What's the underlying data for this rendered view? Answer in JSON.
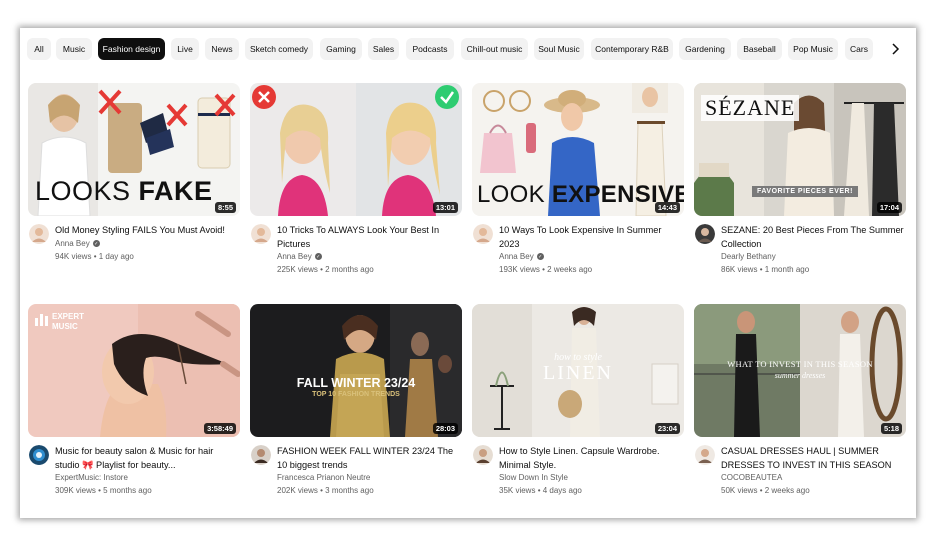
{
  "chips": [
    {
      "label": "All",
      "active": false
    },
    {
      "label": "Music",
      "active": false
    },
    {
      "label": "Fashion design",
      "active": true
    },
    {
      "label": "Live",
      "active": false
    },
    {
      "label": "News",
      "active": false
    },
    {
      "label": "Sketch comedy",
      "active": false
    },
    {
      "label": "Gaming",
      "active": false
    },
    {
      "label": "Sales",
      "active": false
    },
    {
      "label": "Podcasts",
      "active": false
    },
    {
      "label": "Chill-out music",
      "active": false
    },
    {
      "label": "Soul Music",
      "active": false
    },
    {
      "label": "Contemporary R&B",
      "active": false
    },
    {
      "label": "Gardening",
      "active": false
    },
    {
      "label": "Baseball",
      "active": false
    },
    {
      "label": "Pop Music",
      "active": false
    },
    {
      "label": "Cars",
      "active": false
    }
  ],
  "chips_next_icon": "chevron-right-icon",
  "videos": [
    {
      "title": "Old Money Styling FAILS You Must Avoid!",
      "channel": "Anna Bey",
      "verified": true,
      "views": "94K views",
      "age": "1 day ago",
      "duration": "8:55",
      "overlay": {
        "plain": "LOOKS ",
        "bold": "FAKE"
      }
    },
    {
      "title": "10 Tricks To ALWAYS Look Your Best In Pictures",
      "channel": "Anna Bey",
      "verified": true,
      "views": "225K views",
      "age": "2 months ago",
      "duration": "13:01"
    },
    {
      "title": "10 Ways To Look Expensive In Summer 2023",
      "channel": "Anna Bey",
      "verified": true,
      "views": "193K views",
      "age": "2 weeks ago",
      "duration": "14:43",
      "overlay": {
        "plain": "LOOK ",
        "bold": "EXPENSIVE"
      }
    },
    {
      "title": "SEZANE: 20 Best Pieces From The Summer Collection",
      "channel": "Dearly Bethany",
      "verified": false,
      "views": "86K views",
      "age": "1 month ago",
      "duration": "17:04",
      "overlay": {
        "brand": "SÉZANE",
        "banner": "FAVORITE PIECES EVER!"
      }
    },
    {
      "title": "Music for beauty salon & Music for hair studio 🎀 Playlist for beauty...",
      "channel": "ExpertMusic: Instore",
      "verified": false,
      "views": "309K views",
      "age": "5 months ago",
      "duration": "3:58:49",
      "overlay": {
        "logo_line1": "EXPERT",
        "logo_line2": "MUSIC"
      }
    },
    {
      "title": "FASHION WEEK FALL WINTER 23/24 The 10 biggest trends",
      "channel": "Francesca Prianon Neutre",
      "verified": false,
      "views": "202K views",
      "age": "3 months ago",
      "duration": "28:03",
      "overlay": {
        "line1": "FALL WINTER 23/24",
        "line2": "TOP 10 FASHION TRENDS"
      }
    },
    {
      "title": "How to Style Linen. Capsule Wardrobe. Minimal Style.",
      "channel": "Slow Down In Style",
      "verified": false,
      "views": "35K views",
      "age": "4 days ago",
      "duration": "23:04",
      "overlay": {
        "line1": "how to style",
        "line2": "LINEN"
      }
    },
    {
      "title": "CASUAL DRESSES HAUL | SUMMER DRESSES TO INVEST IN THIS SEASON",
      "channel": "COCOBEAUTEA",
      "verified": false,
      "views": "50K views",
      "age": "2 weeks ago",
      "duration": "5:18",
      "overlay": {
        "line1": "WHAT TO INVEST IN THIS SEASON",
        "line2": "summer dresses"
      }
    }
  ],
  "colors": {
    "chip_bg": "#f2f2f2",
    "chip_active_bg": "#0f0f0f",
    "text_primary": "#0f0f0f",
    "text_secondary": "#606060",
    "reject_red": "#e53935",
    "approve_green": "#2ecc71"
  }
}
